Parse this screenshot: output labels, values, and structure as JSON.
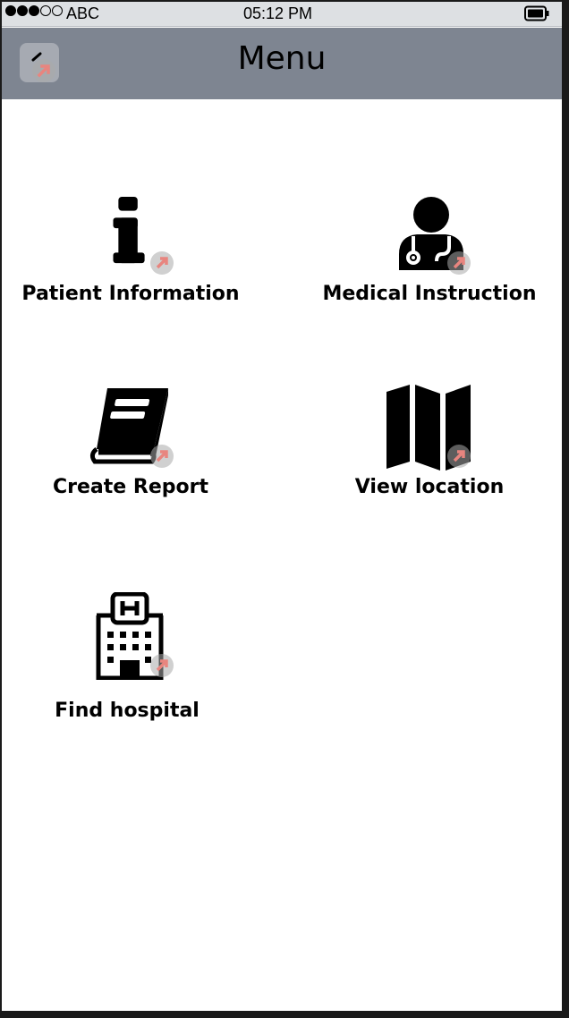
{
  "status_bar": {
    "carrier": "ABC",
    "time": "05:12 PM",
    "signal_bars_filled": 3,
    "signal_bars_total": 5
  },
  "nav": {
    "title": "Menu",
    "back_icon": "chevron-left-icon"
  },
  "menu": {
    "items": [
      {
        "label": "Patient Information",
        "icon": "info-icon"
      },
      {
        "label": "Medical Instruction",
        "icon": "doctor-icon"
      },
      {
        "label": "Create Report",
        "icon": "book-icon"
      },
      {
        "label": "View location",
        "icon": "map-icon"
      },
      {
        "label": "Find hospital",
        "icon": "hospital-icon"
      }
    ]
  },
  "colors": {
    "nav_background": "#7e8591",
    "status_background": "#dde0e3",
    "link_arrow": "#e8857f"
  }
}
